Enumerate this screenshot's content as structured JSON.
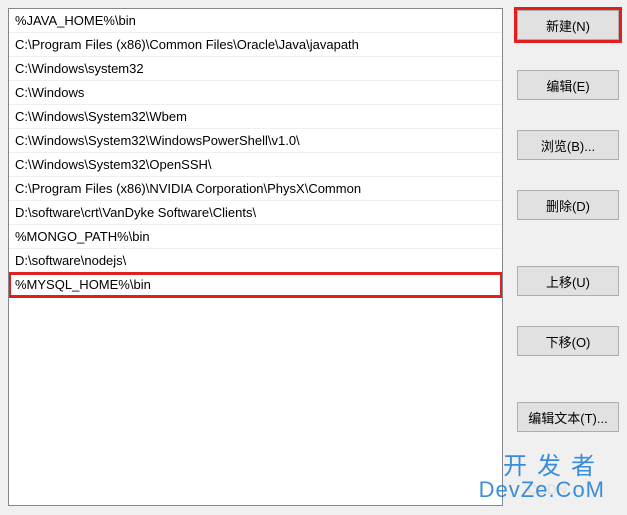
{
  "path_entries": [
    "%JAVA_HOME%\\bin",
    "C:\\Program Files (x86)\\Common Files\\Oracle\\Java\\javapath",
    "C:\\Windows\\system32",
    "C:\\Windows",
    "C:\\Windows\\System32\\Wbem",
    "C:\\Windows\\System32\\WindowsPowerShell\\v1.0\\",
    "C:\\Windows\\System32\\OpenSSH\\",
    "C:\\Program Files (x86)\\NVIDIA Corporation\\PhysX\\Common",
    "D:\\software\\crt\\VanDyke Software\\Clients\\",
    "%MONGO_PATH%\\bin",
    "D:\\software\\nodejs\\",
    "%MYSQL_HOME%\\bin"
  ],
  "highlighted_entry_index": 11,
  "buttons": {
    "new": "新建(N)",
    "edit": "编辑(E)",
    "browse": "浏览(B)...",
    "delete": "删除(D)",
    "move_up": "上移(U)",
    "move_down": "下移(O)",
    "edit_text": "编辑文本(T)..."
  },
  "highlighted_button": "new",
  "watermark": {
    "line1": "开发者",
    "line2": "DevZe.CoM",
    "csdn": "CSDN"
  }
}
